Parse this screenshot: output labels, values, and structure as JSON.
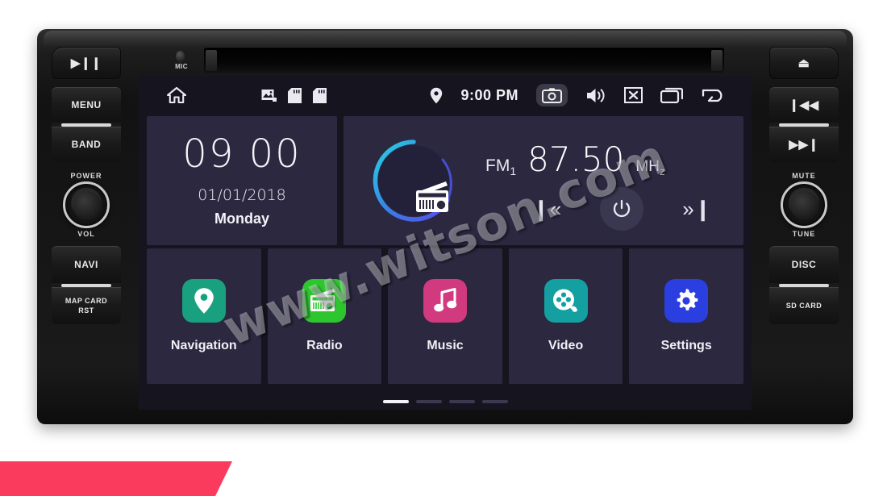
{
  "device": {
    "mic_label": "MIC"
  },
  "left_buttons": [
    {
      "name": "play-pause",
      "glyph": "▶❙❙",
      "label": ""
    },
    {
      "name": "menu",
      "glyph": "",
      "label": "MENU"
    },
    {
      "name": "band",
      "glyph": "",
      "label": "BAND"
    },
    {
      "name": "navi",
      "glyph": "",
      "label": "NAVI"
    },
    {
      "name": "map-card-rst",
      "glyph": "",
      "label": "MAP CARD\nRST"
    }
  ],
  "left_knob": {
    "top_label": "POWER",
    "bottom_label": "VOL"
  },
  "right_buttons": [
    {
      "name": "eject",
      "glyph": "⏏",
      "label": ""
    },
    {
      "name": "previous-track",
      "glyph": "❙◀◀",
      "label": ""
    },
    {
      "name": "next-track",
      "glyph": "▶▶❙",
      "label": ""
    },
    {
      "name": "disc",
      "glyph": "",
      "label": "DISC"
    },
    {
      "name": "sd-card",
      "glyph": "",
      "label": "SD CARD"
    }
  ],
  "right_knob": {
    "top_label": "MUTE",
    "bottom_label": "TUNE"
  },
  "statusbar": {
    "home_icon": "home-icon",
    "gallery_icon": "gallery-icon",
    "sd1_icon": "sd-card-icon",
    "sd2_icon": "sd-card-icon",
    "location_icon": "location-pin-icon",
    "time": "9:00 PM",
    "camera_icon": "camera-icon",
    "volume_icon": "volume-icon",
    "mute_box_icon": "close-box-icon",
    "recents_icon": "recents-icon",
    "back_icon": "back-arrow-icon"
  },
  "clock_widget": {
    "time": "09 00",
    "date": "01/01/2018",
    "day": "Monday"
  },
  "radio_widget": {
    "icon": "radio-icon",
    "band": "FM",
    "band_index": "1",
    "frequency": "87.50",
    "unit": "MH",
    "unit_sub": "z",
    "prev_label": "❙«",
    "power_label": "power-icon",
    "next_label": "»❙",
    "arc_color_start": "#25d4e0",
    "arc_color_end": "#4a57e8"
  },
  "apps": [
    {
      "label": "Navigation",
      "icon": "location-pin-icon",
      "color": "#18a07f"
    },
    {
      "label": "Radio",
      "icon": "radio-icon",
      "color": "#2ec62e"
    },
    {
      "label": "Music",
      "icon": "music-note-icon",
      "color": "#d13a7e"
    },
    {
      "label": "Video",
      "icon": "film-reel-icon",
      "color": "#14a0a0"
    },
    {
      "label": "Settings",
      "icon": "gear-icon",
      "color": "#2b3fe0"
    }
  ],
  "pagination": {
    "total": 4,
    "active": 1
  },
  "watermark": {
    "text": "www.witson.com"
  },
  "banner": {
    "color": "#fb3b5e"
  },
  "theme": {
    "screen_bg": "#16141f",
    "card_bg": "#2b2840",
    "text": "#f2f2f7"
  }
}
